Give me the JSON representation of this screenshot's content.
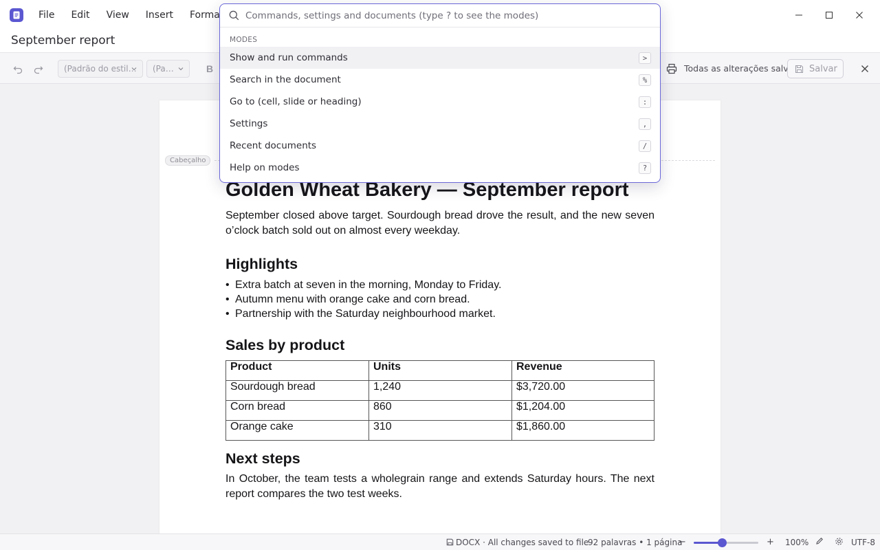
{
  "app": {
    "menu": [
      "File",
      "Edit",
      "View",
      "Insert",
      "Forma"
    ]
  },
  "document_title": "September report",
  "toolbar": {
    "style_select": "(Padrão do estil…",
    "paragraph_select": "(Pa…",
    "bold_glyph": "B",
    "status": "Todas as alterações salvas",
    "save_label": "Salvar"
  },
  "page": {
    "header_tag": "Cabeçalho",
    "title": "Golden Wheat Bakery — September report",
    "intro": "September closed above target. Sourdough bread drove the result, and the new seven o’clock batch sold out on almost every weekday.",
    "highlights_heading": "Highlights",
    "highlights": [
      "Extra batch at seven in the morning, Monday to Friday.",
      "Autumn menu with orange cake and corn bread.",
      "Partnership with the Saturday neighbourhood market."
    ],
    "sales_heading": "Sales by product",
    "table": {
      "headers": [
        "Product",
        "Units",
        "Revenue"
      ],
      "rows": [
        [
          "Sourdough bread",
          "1,240",
          "$3,720.00"
        ],
        [
          "Corn bread",
          "860",
          "$1,204.00"
        ],
        [
          "Orange cake",
          "310",
          "$1,860.00"
        ]
      ]
    },
    "next_heading": "Next steps",
    "next_text": "In October, the team tests a wholegrain range and extends Saturday hours. The next report compares the two test weeks."
  },
  "palette": {
    "placeholder": "Commands, settings and documents (type ? to see the modes)",
    "section_label": "MODES",
    "items": [
      {
        "label": "Show and run commands",
        "key": ">"
      },
      {
        "label": "Search in the document",
        "key": "%"
      },
      {
        "label": "Go to (cell, slide or heading)",
        "key": ":"
      },
      {
        "label": "Settings",
        "key": ","
      },
      {
        "label": "Recent documents",
        "key": "/"
      },
      {
        "label": "Help on modes",
        "key": "?"
      }
    ]
  },
  "statusbar": {
    "file_status": "DOCX · All changes saved to file",
    "word_count": "92 palavras • 1 página",
    "zoom_minus": "−",
    "zoom_plus": "+",
    "zoom": "100%",
    "zoom_fraction": 0.44,
    "encoding": "UTF-8"
  },
  "colors": {
    "accent": "#5b57d1"
  }
}
